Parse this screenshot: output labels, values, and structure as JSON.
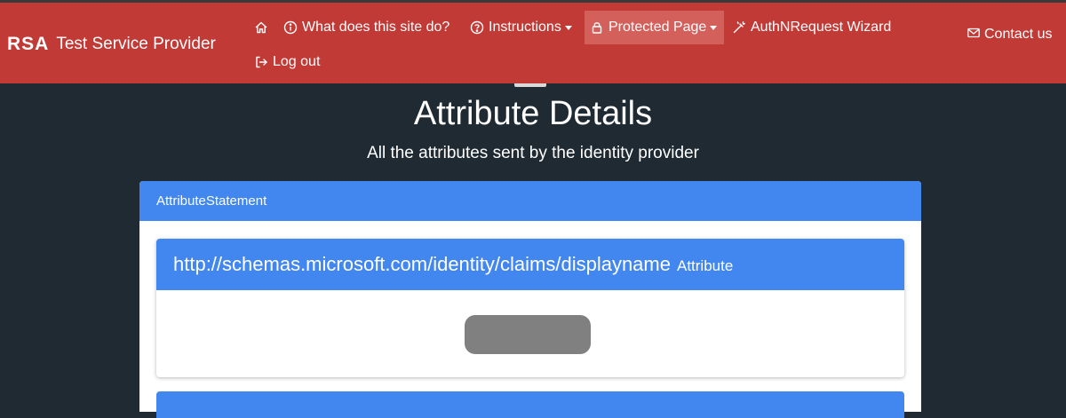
{
  "brand": {
    "logo": "RSA",
    "name": "Test Service Provider"
  },
  "nav": {
    "home_icon": "home-icon",
    "items": [
      {
        "label": "What does this site do?",
        "icon": "info-circle-icon"
      },
      {
        "label": "Instructions",
        "icon": "question-circle-icon",
        "dropdown": true
      },
      {
        "label": "Protected Page",
        "icon": "lock-icon",
        "dropdown": true,
        "active": true
      },
      {
        "label": "AuthNRequest Wizard",
        "icon": "magic-wand-icon"
      },
      {
        "label": "Log out",
        "icon": "logout-icon"
      }
    ],
    "contact": {
      "label": "Contact us",
      "icon": "envelope-icon"
    }
  },
  "page": {
    "title": "Attribute Details",
    "subtitle": "All the attributes sent by the identity provider"
  },
  "attribute_statement": {
    "header": "AttributeStatement",
    "attributes": [
      {
        "name": "http://schemas.microsoft.com/identity/claims/displayname",
        "suffix": "Attribute",
        "value_redacted": true
      }
    ]
  },
  "colors": {
    "navbar": "#c23a36",
    "navbar_active": "#d4605c",
    "background": "#1f2a33",
    "card_header": "#4286f0",
    "redaction": "#808080"
  }
}
